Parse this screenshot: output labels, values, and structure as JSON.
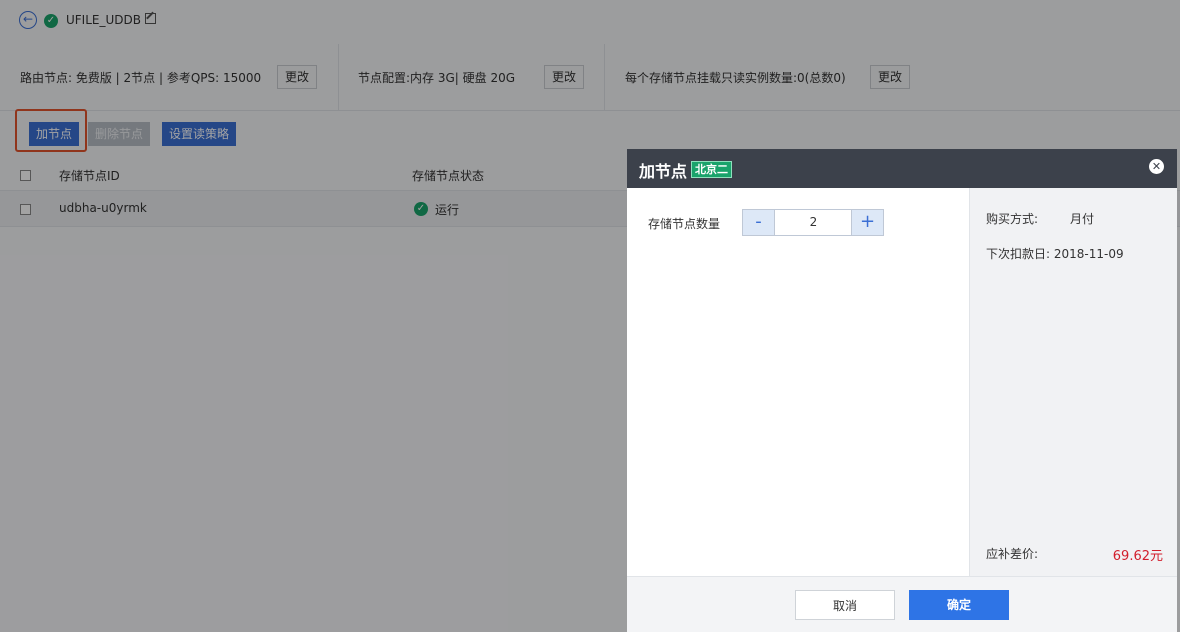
{
  "header": {
    "back_icon": "arrow-left-icon",
    "status_icon": "check-circle-icon",
    "instance_name": "UFILE_UDDB",
    "edit_icon": "edit-icon"
  },
  "config": {
    "route_text": "路由节点: 免费版 | 2节点 | 参考QPS: 15000",
    "node_text": "节点配置:内存  3G| 硬盘  20G",
    "readonly_text": "每个存储节点挂载只读实例数量:0(总数0)",
    "change_label": "更改"
  },
  "actions": {
    "add_node": "加节点",
    "delete_node": "删除节点",
    "set_policy": "设置读策略"
  },
  "table": {
    "headers": [
      "存储节点ID",
      "存储节点状态"
    ],
    "rows": [
      {
        "id": "udbha-u0yrmk",
        "status": "运行"
      }
    ]
  },
  "modal": {
    "title": "加节点",
    "region": "北京二",
    "close_icon": "close-icon",
    "quantity_label": "存储节点数量",
    "minus": "-",
    "plus": "+",
    "quantity_value": "2",
    "purchase_label": "购买方式:",
    "purchase_value": "月付",
    "next_charge": "下次扣款日: 2018-11-09",
    "diff_label": "应补差价:",
    "diff_value": "69.62元",
    "cancel": "取消",
    "confirm": "确定"
  },
  "colors": {
    "accent": "#3b6fd4",
    "success": "#1aa36b",
    "price": "#d21f2c",
    "highlight": "#e2532d"
  }
}
